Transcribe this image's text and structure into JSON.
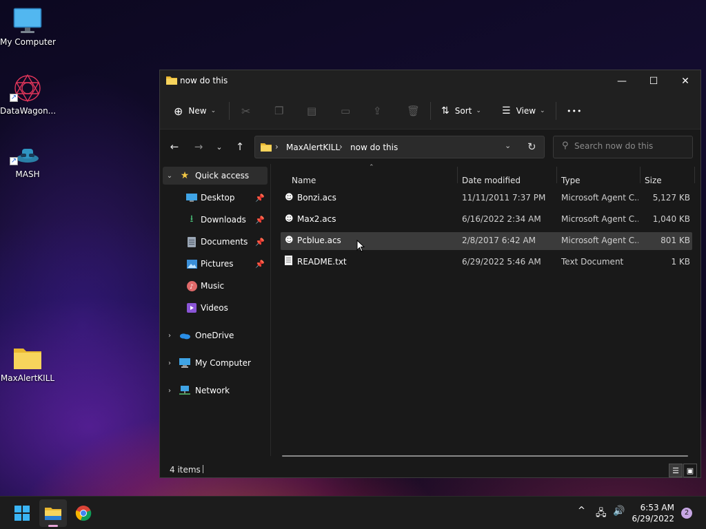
{
  "desktop": {
    "icons": [
      {
        "label": "My Computer"
      },
      {
        "label": "DataWagon..."
      },
      {
        "label": "MASH"
      },
      {
        "label": "MaxAlertKILL"
      }
    ]
  },
  "window": {
    "title": "now do this",
    "controls": {
      "minimize": "—",
      "maximize": "☐",
      "close": "✕"
    }
  },
  "commandbar": {
    "new_label": "New",
    "sort_label": "Sort",
    "view_label": "View",
    "more_label": "•••"
  },
  "addressbar": {
    "breadcrumb": [
      "MaxAlertKILL",
      "now do this"
    ],
    "search_placeholder": "Search now do this"
  },
  "navpane": {
    "quick_access": "Quick access",
    "pinned": [
      {
        "label": "Desktop",
        "icon": "desktop-icon",
        "pinned": true
      },
      {
        "label": "Downloads",
        "icon": "downloads-icon",
        "pinned": true
      },
      {
        "label": "Documents",
        "icon": "documents-icon",
        "pinned": true
      },
      {
        "label": "Pictures",
        "icon": "pictures-icon",
        "pinned": true
      },
      {
        "label": "Music",
        "icon": "music-icon",
        "pinned": false
      },
      {
        "label": "Videos",
        "icon": "videos-icon",
        "pinned": false
      }
    ],
    "roots": [
      {
        "label": "OneDrive",
        "icon": "onedrive-icon"
      },
      {
        "label": "My Computer",
        "icon": "computer-icon"
      },
      {
        "label": "Network",
        "icon": "network-icon"
      }
    ]
  },
  "filelist": {
    "columns": {
      "name": "Name",
      "modified": "Date modified",
      "type": "Type",
      "size": "Size"
    },
    "rows": [
      {
        "name": "Bonzi.acs",
        "modified": "11/11/2011 7:37 PM",
        "type": "Microsoft Agent C...",
        "size": "5,127 KB",
        "icon": "agent-file-icon"
      },
      {
        "name": "Max2.acs",
        "modified": "6/16/2022 2:34 AM",
        "type": "Microsoft Agent C...",
        "size": "1,040 KB",
        "icon": "agent-file-icon"
      },
      {
        "name": "Pcblue.acs",
        "modified": "2/8/2017 6:42 AM",
        "type": "Microsoft Agent C...",
        "size": "801 KB",
        "icon": "agent-file-icon"
      },
      {
        "name": "README.txt",
        "modified": "6/29/2022 5:46 AM",
        "type": "Text Document",
        "size": "1 KB",
        "icon": "text-file-icon"
      }
    ]
  },
  "statusbar": {
    "items": "4 items"
  },
  "taskbar": {
    "time": "6:53 AM",
    "date": "6/29/2022",
    "notifications": "2",
    "tray_chevron": "^"
  },
  "colors": {
    "window_bg": "#191919",
    "titlebar_bg": "#202020",
    "selected_row": "#3b3b3b",
    "folder_yellow": "#f5c84c",
    "accent_pink": "#e7a6d8"
  }
}
